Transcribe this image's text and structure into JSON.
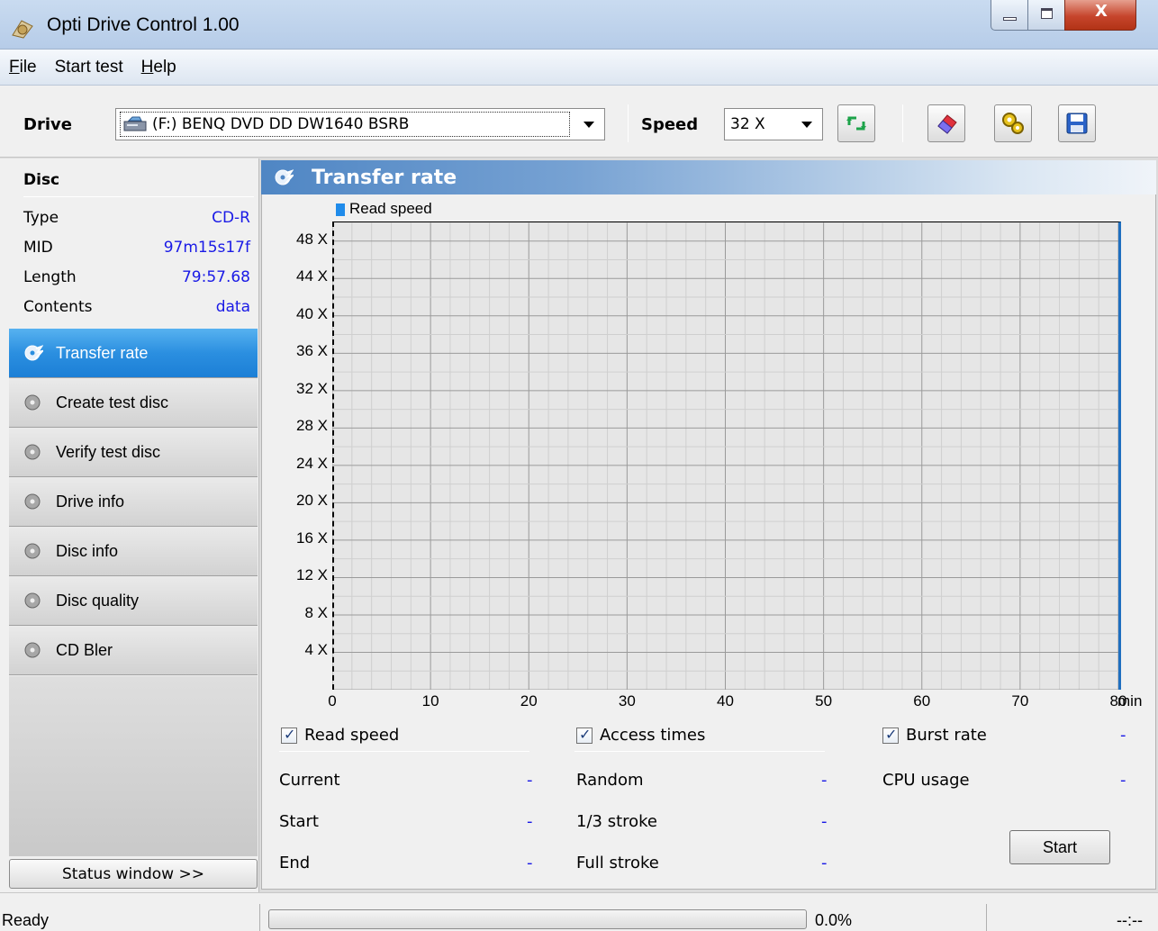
{
  "window": {
    "title": "Opti Drive Control 1.00",
    "close_glyph": "X"
  },
  "menu": [
    {
      "label": "File",
      "underline": "F",
      "rest": "ile"
    },
    {
      "label": "Start test",
      "underline": "",
      "rest": "Start test"
    },
    {
      "label": "Help",
      "underline": "H",
      "rest": "elp"
    }
  ],
  "toolbar": {
    "drive_label": "Drive",
    "drive_value": "(F:)  BENQ DVD DD DW1640 BSRB",
    "speed_label": "Speed",
    "speed_value": "32 X",
    "icons": [
      "refresh-icon",
      "eraser-icon",
      "settings-icon",
      "save-icon"
    ]
  },
  "disc": {
    "heading": "Disc",
    "rows": [
      {
        "key": "Type",
        "value": "CD-R"
      },
      {
        "key": "MID",
        "value": "97m15s17f"
      },
      {
        "key": "Length",
        "value": "79:57.68"
      },
      {
        "key": "Contents",
        "value": "data"
      }
    ]
  },
  "nav": [
    {
      "label": "Transfer rate",
      "active": true
    },
    {
      "label": "Create test disc",
      "active": false
    },
    {
      "label": "Verify test disc",
      "active": false
    },
    {
      "label": "Drive info",
      "active": false
    },
    {
      "label": "Disc info",
      "active": false
    },
    {
      "label": "Disc quality",
      "active": false
    },
    {
      "label": "CD Bler",
      "active": false
    }
  ],
  "status_window_button": "Status window >>",
  "panel": {
    "title": "Transfer rate"
  },
  "chart_data": {
    "type": "line",
    "title": "",
    "legend": [
      "Read speed"
    ],
    "legend_position": "top-left",
    "x_ticks": [
      "0",
      "10",
      "20",
      "30",
      "40",
      "50",
      "60",
      "70",
      "80"
    ],
    "x_unit": "min",
    "xlim": [
      0,
      80
    ],
    "y_ticks": [
      "4 X",
      "8 X",
      "12 X",
      "16 X",
      "20 X",
      "24 X",
      "28 X",
      "32 X",
      "36 X",
      "40 X",
      "44 X",
      "48 X"
    ],
    "ylim": [
      0,
      50
    ],
    "grid": true,
    "series": []
  },
  "checks": {
    "read_speed": "Read speed",
    "access_times": "Access times",
    "burst_rate": "Burst rate"
  },
  "stats": {
    "read": [
      {
        "label": "Current",
        "value": "-"
      },
      {
        "label": "Start",
        "value": "-"
      },
      {
        "label": "End",
        "value": "-"
      }
    ],
    "access": [
      {
        "label": "Random",
        "value": "-"
      },
      {
        "label": "1/3 stroke",
        "value": "-"
      },
      {
        "label": "Full stroke",
        "value": "-"
      }
    ],
    "burst_value": "-",
    "cpu_label": "CPU usage",
    "cpu_value": "-"
  },
  "start_button": "Start",
  "statusbar": {
    "status": "Ready",
    "progress": 0.0,
    "percent": "0.0%",
    "time": "--:--"
  },
  "colors": {
    "accent": "#2b8fe0",
    "value_text": "#1a1ae6",
    "series_read": "#1f8bea"
  }
}
